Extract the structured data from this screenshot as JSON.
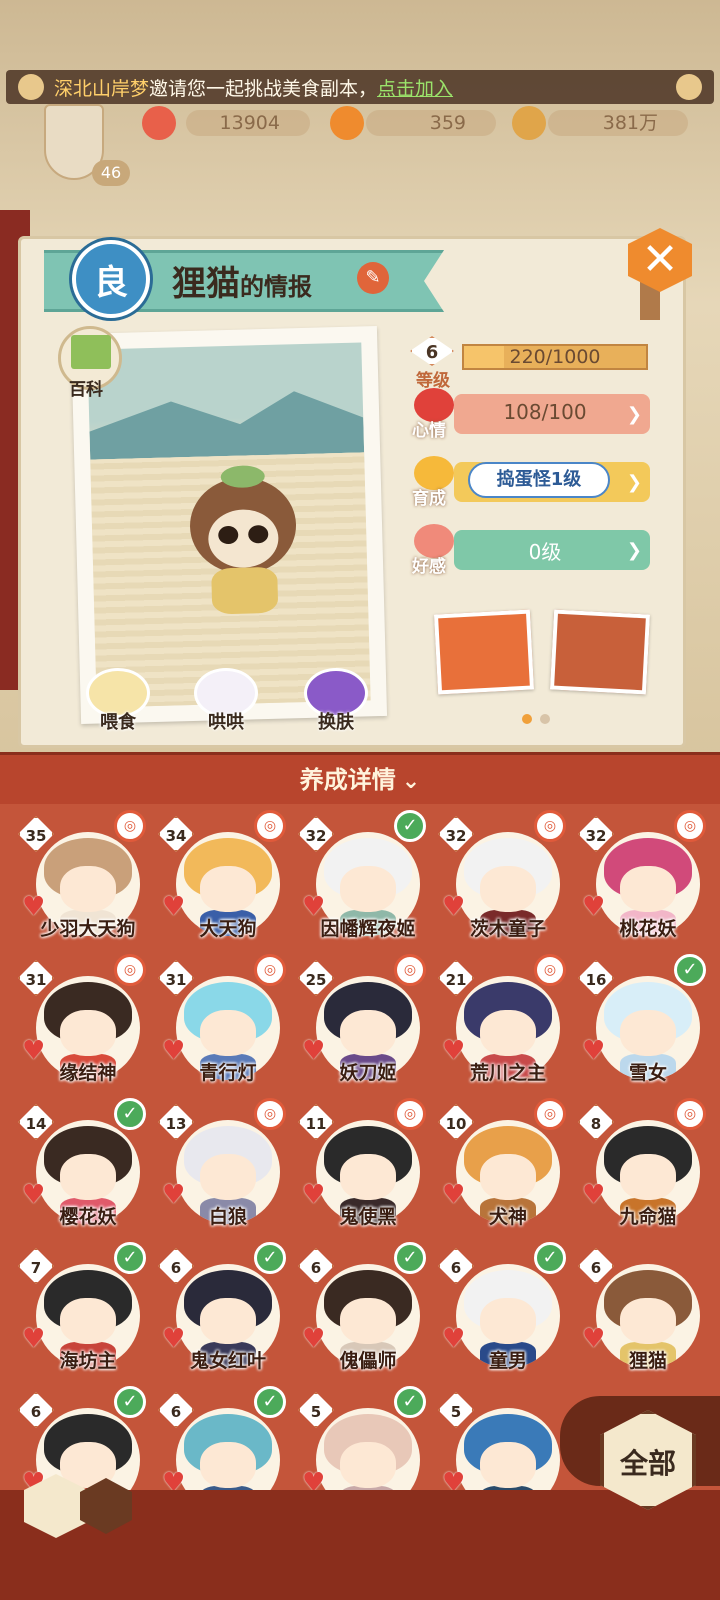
{
  "banner": {
    "inviter": "深北山岸梦",
    "message": "邀请您一起挑战美食副本，",
    "join_label": "点击加入"
  },
  "hud": {
    "player_level": "46",
    "stat_a": "13904",
    "stat_b": "359",
    "stat_c": "381万"
  },
  "info_card": {
    "grade": "良",
    "name": "狸猫",
    "title_suffix": "的情报",
    "encyclopedia_label": "百科",
    "level": {
      "value": "6",
      "label": "等级",
      "exp": "220/1000",
      "progress": 0.22
    },
    "mood": {
      "label": "心情",
      "value": "108/100"
    },
    "growth": {
      "label": "育成",
      "value": "捣蛋怪1级"
    },
    "favor": {
      "label": "好感",
      "value": "0级"
    },
    "actions": [
      {
        "label": "喂食"
      },
      {
        "label": "哄哄"
      },
      {
        "label": "换肤"
      }
    ],
    "page_dots": 2,
    "current_page": 1
  },
  "detail": {
    "title": "养成详情",
    "chevron": "⌄"
  },
  "characters": [
    {
      "level": "35",
      "name": "少羽大天狗",
      "status": "food",
      "hair": "#c9a07a",
      "body": "#f0e4d4"
    },
    {
      "level": "34",
      "name": "大天狗",
      "status": "food",
      "hair": "#f2b95a",
      "body": "#3a5fa8"
    },
    {
      "level": "32",
      "name": "因幡辉夜姬",
      "status": "check",
      "hair": "#f2f2f2",
      "body": "#8fb8a8"
    },
    {
      "level": "32",
      "name": "茨木童子",
      "status": "food",
      "hair": "#f2f2f2",
      "body": "#7a2a2a"
    },
    {
      "level": "32",
      "name": "桃花妖",
      "status": "food",
      "hair": "#d14a7a",
      "body": "#f2b6c8"
    },
    {
      "level": "31",
      "name": "缘结神",
      "status": "food",
      "hair": "#3a2a22",
      "body": "#d84a3a"
    },
    {
      "level": "31",
      "name": "青行灯",
      "status": "food",
      "hair": "#8ad8e8",
      "body": "#5a7ab8"
    },
    {
      "level": "25",
      "name": "妖刀姬",
      "status": "food",
      "hair": "#2a2a3a",
      "body": "#6a4a8a"
    },
    {
      "level": "21",
      "name": "荒川之主",
      "status": "food",
      "hair": "#3a3a6a",
      "body": "#c84a4a"
    },
    {
      "level": "16",
      "name": "雪女",
      "status": "check",
      "hair": "#d8eef8",
      "body": "#bcd8ec"
    },
    {
      "level": "14",
      "name": "樱花妖",
      "status": "check",
      "hair": "#3a2a22",
      "body": "#e05a6a"
    },
    {
      "level": "13",
      "name": "白狼",
      "status": "food",
      "hair": "#e8e8ee",
      "body": "#8a8aa8"
    },
    {
      "level": "11",
      "name": "鬼使黑",
      "status": "food",
      "hair": "#2a2a2a",
      "body": "#3a2a2a"
    },
    {
      "level": "10",
      "name": "犬神",
      "status": "food",
      "hair": "#e8a04a",
      "body": "#b8743a"
    },
    {
      "level": "8",
      "name": "九命猫",
      "status": "food",
      "hair": "#2a2a2a",
      "body": "#c8742a"
    },
    {
      "level": "7",
      "name": "海坊主",
      "status": "check",
      "hair": "#2a2a2a",
      "body": "#c8443a"
    },
    {
      "level": "6",
      "name": "鬼女红叶",
      "status": "check",
      "hair": "#2a2a3a",
      "body": "#3a3a5a"
    },
    {
      "level": "6",
      "name": "傀儡师",
      "status": "check",
      "hair": "#3a2a22",
      "body": "#d8c8b8"
    },
    {
      "level": "6",
      "name": "童男",
      "status": "check",
      "hair": "#f2f2f2",
      "body": "#2a4a8a"
    },
    {
      "level": "6",
      "name": "狸猫",
      "status": "none",
      "hair": "#8a5a3a",
      "body": "#e4c46a"
    },
    {
      "level": "6",
      "name": "",
      "status": "check",
      "hair": "#2a2a2a",
      "body": "#c8443a"
    },
    {
      "level": "6",
      "name": "",
      "status": "check",
      "hair": "#6ab8c8",
      "body": "#3a5a8a"
    },
    {
      "level": "5",
      "name": "",
      "status": "check",
      "hair": "#e8c8b8",
      "body": "#c8a8a8"
    },
    {
      "level": "5",
      "name": "",
      "status": "none",
      "hair": "#3a7ab8",
      "body": "#2a4a6a"
    }
  ],
  "bottom": {
    "filter_label": "全部"
  },
  "colors": {
    "grid_bg": "#c4553a",
    "check_green": "#4caa5a",
    "mood_bar": "#f0a890",
    "growth_bar": "#f3c95a",
    "favor_bar": "#7fc8a8",
    "grade_blue": "#3e8fc4"
  }
}
